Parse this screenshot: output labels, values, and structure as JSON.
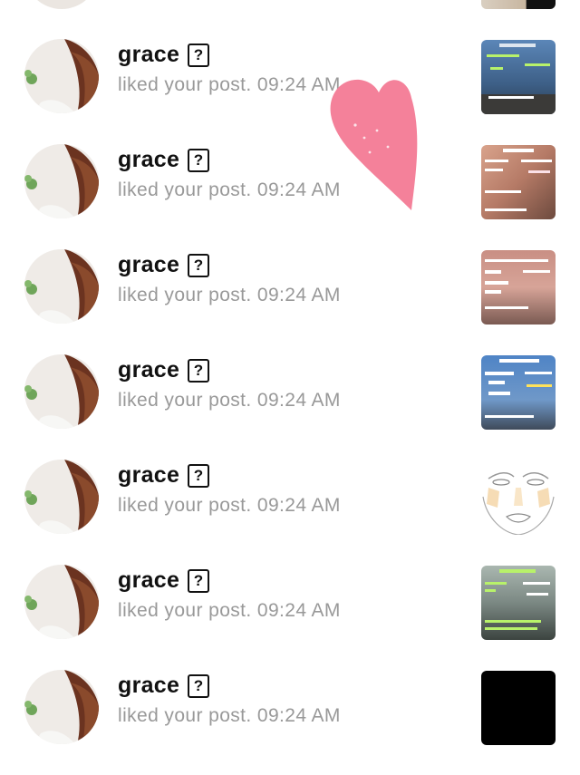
{
  "notifications": [
    {
      "username": "grace",
      "badge": "?",
      "text": "liked your post. 09:24 AM",
      "thumb_theme": "blue-sea"
    },
    {
      "username": "grace",
      "badge": "?",
      "text": "liked your post. 09:24 AM",
      "thumb_theme": "peach-sky"
    },
    {
      "username": "grace",
      "badge": "?",
      "text": "liked your post. 09:24 AM",
      "thumb_theme": "pink-sky"
    },
    {
      "username": "grace",
      "badge": "?",
      "text": "liked your post. 09:24 AM",
      "thumb_theme": "blue-sky"
    },
    {
      "username": "grace",
      "badge": "?",
      "text": "liked your post. 09:24 AM",
      "thumb_theme": "face-sketch"
    },
    {
      "username": "grace",
      "badge": "?",
      "text": "liked your post. 09:24 AM",
      "thumb_theme": "grey-sky"
    },
    {
      "username": "grace",
      "badge": "?",
      "text": "liked your post. 09:24 AM",
      "thumb_theme": "black"
    }
  ],
  "colors": {
    "heart": "#f4819a",
    "username": "#111111",
    "subtext": "#999999"
  },
  "icons": {
    "heart_overlay": "heart-icon",
    "badge": "question-box-icon"
  }
}
